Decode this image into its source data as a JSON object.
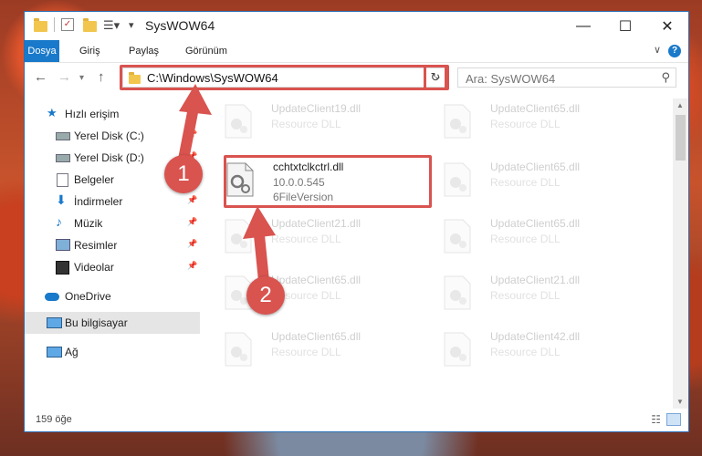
{
  "window": {
    "title": "SysWOW64",
    "controls": {
      "minimize": "—",
      "maximize": "☐",
      "close": "✕"
    }
  },
  "ribbon": {
    "tabs": [
      "Dosya",
      "Giriş",
      "Paylaş",
      "Görünüm"
    ]
  },
  "address": {
    "path": "C:\\Windows\\SysWOW64",
    "search_placeholder": "Ara: SysWOW64"
  },
  "sidebar": {
    "items": [
      {
        "label": "Hızlı erişim",
        "icon": "star-icon"
      },
      {
        "label": "Yerel Disk (C:)",
        "icon": "drive-icon",
        "pinned": true
      },
      {
        "label": "Yerel Disk (D:)",
        "icon": "drive-icon",
        "pinned": true
      },
      {
        "label": "Belgeler",
        "icon": "document-icon",
        "pinned": true
      },
      {
        "label": "İndirmeler",
        "icon": "download-icon",
        "pinned": true
      },
      {
        "label": "Müzik",
        "icon": "music-icon",
        "pinned": true
      },
      {
        "label": "Resimler",
        "icon": "picture-icon",
        "pinned": true
      },
      {
        "label": "Videolar",
        "icon": "video-icon",
        "pinned": true
      },
      {
        "label": "OneDrive",
        "icon": "cloud-icon"
      },
      {
        "label": "Bu bilgisayar",
        "icon": "computer-icon",
        "selected": true
      },
      {
        "label": "Ağ",
        "icon": "network-icon"
      }
    ]
  },
  "files": {
    "highlighted": {
      "name": "cchtxtclkctrl.dll",
      "version": "10.0.0.545",
      "desc": "6FileVersion"
    },
    "faded": [
      {
        "name": "UpdateClient19.dll",
        "desc": "Resource DLL"
      },
      {
        "name": "UpdateClient65.dll",
        "desc": "Resource DLL"
      },
      {
        "name": "UpdateClient65.dll",
        "desc": "Resource DLL"
      },
      {
        "name": "UpdateClient21.dll",
        "desc": "Resource DLL"
      },
      {
        "name": "UpdateClient65.dll",
        "desc": "Resource DLL"
      },
      {
        "name": "UpdateClient65.dll",
        "desc": "Resource DLL"
      },
      {
        "name": "UpdateClient21.dll",
        "desc": "Resource DLL"
      },
      {
        "name": "UpdateClient65.dll",
        "desc": "Resource DLL"
      },
      {
        "name": "UpdateClient42.dll",
        "desc": "Resource DLL"
      }
    ]
  },
  "status": {
    "count": "159 öğe"
  },
  "annotations": {
    "step1": "1",
    "step2": "2"
  },
  "colors": {
    "accent": "#1979ca",
    "highlight": "#d9534f"
  }
}
